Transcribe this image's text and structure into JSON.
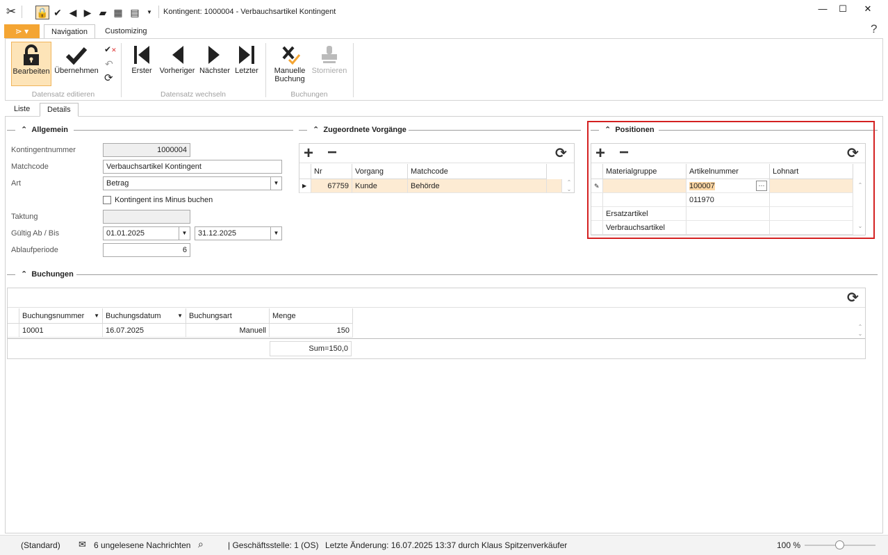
{
  "window": {
    "title": "Kontingent: 1000004 - Verbauchsartikel Kontingent",
    "minimize": "—",
    "maximize": "☐",
    "close": "✕",
    "help": "?"
  },
  "ribbon": {
    "tabs": [
      {
        "label": "Navigation"
      },
      {
        "label": "Customizing"
      }
    ],
    "buttons": {
      "bearbeiten": "Bearbeiten",
      "uebernehmen": "Übernehmen",
      "erster": "Erster",
      "vorheriger": "Vorheriger",
      "naechster": "Nächster",
      "letzter": "Letzter",
      "manuelle_buchung_line1": "Manuelle",
      "manuelle_buchung_line2": "Buchung",
      "stornieren": "Stornieren"
    },
    "groups": {
      "datensatz_editieren": "Datensatz editieren",
      "datensatz_wechseln": "Datensatz wechseln",
      "buchungen": "Buchungen"
    }
  },
  "subtabs": [
    {
      "label": "Liste"
    },
    {
      "label": "Details"
    }
  ],
  "allgemein": {
    "title": "Allgemein",
    "kontingentnummer_label": "Kontingentnummer",
    "kontingentnummer": "1000004",
    "matchcode_label": "Matchcode",
    "matchcode": "Verbauchsartikel Kontingent",
    "art_label": "Art",
    "art": "Betrag",
    "minus_label": "Kontingent ins Minus buchen",
    "taktung_label": "Taktung",
    "taktung": "",
    "gueltig_label": "Gültig Ab / Bis",
    "gueltig_ab": "01.01.2025",
    "gueltig_bis": "31.12.2025",
    "ablauf_label": "Ablaufperiode",
    "ablauf": "6"
  },
  "vorgaenge": {
    "title": "Zugeordnete Vorgänge",
    "headers": [
      "Nr",
      "Vorgang",
      "Matchcode"
    ],
    "rows": [
      {
        "nr": "67759",
        "vorgang": "Kunde",
        "matchcode": "Behörde"
      }
    ]
  },
  "positionen": {
    "title": "Positionen",
    "headers": [
      "Materialgruppe",
      "Artikelnummer",
      "Lohnart"
    ],
    "rows": [
      {
        "materialgruppe": "",
        "artikelnummer": "100007",
        "lohnart": ""
      },
      {
        "materialgruppe": "",
        "artikelnummer": "011970",
        "lohnart": ""
      },
      {
        "materialgruppe": "Ersatzartikel",
        "artikelnummer": "",
        "lohnart": ""
      },
      {
        "materialgruppe": "Verbrauchsartikel",
        "artikelnummer": "",
        "lohnart": ""
      }
    ],
    "ellipsis": "···"
  },
  "buchungen": {
    "title": "Buchungen",
    "headers": [
      "Buchungsnummer",
      "Buchungsdatum",
      "Buchungsart",
      "Menge"
    ],
    "rows": [
      {
        "nummer": "10001",
        "datum": "16.07.2025",
        "art": "Manuell",
        "menge": "150"
      }
    ],
    "sum": "Sum=150,0"
  },
  "status": {
    "standard": "(Standard)",
    "messages": "6 ungelesene Nachrichten",
    "geschaeftsstelle": "| Geschäftsstelle:  1 (OS)",
    "aenderung": "Letzte Änderung: 16.07.2025 13:37 durch Klaus Spitzenverkäufer",
    "zoom": "100 %",
    "zoom_value": 0.5
  },
  "colors": {
    "accent_orange": "#f4a533",
    "selection": "#fdebd3",
    "highlight_red": "#d42020"
  }
}
